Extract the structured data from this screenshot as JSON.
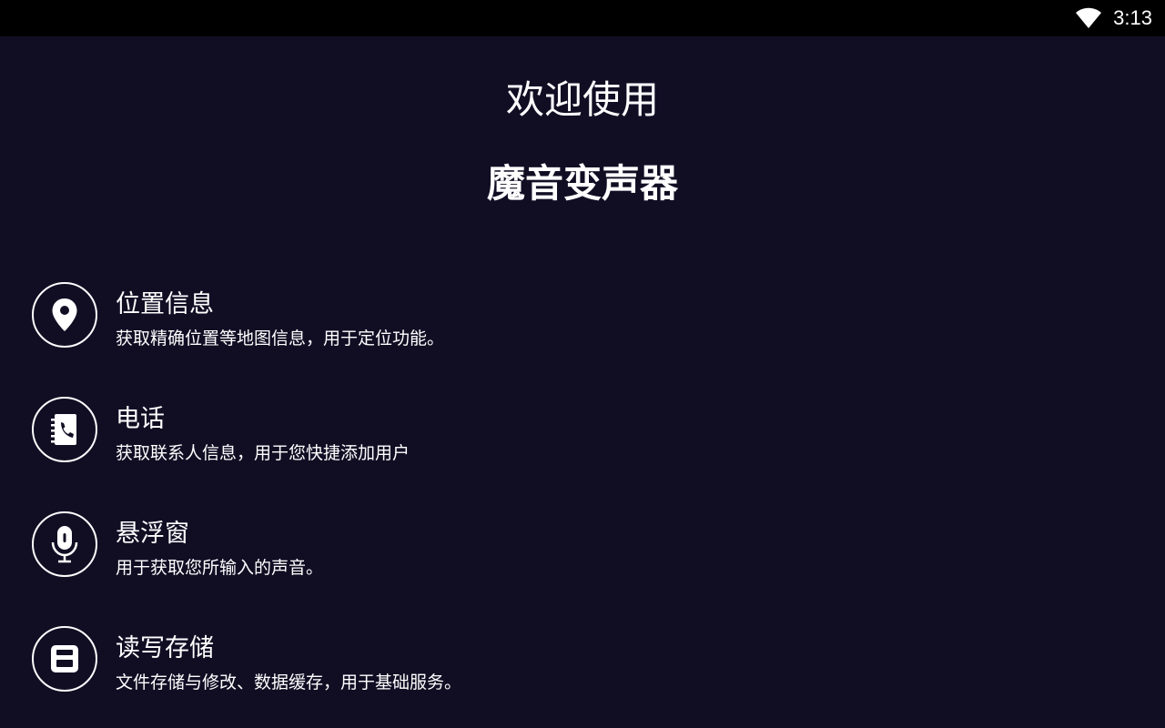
{
  "status_bar": {
    "time": "3:13",
    "wifi_icon": "wifi-icon"
  },
  "header": {
    "welcome": "欢迎使用",
    "app_name": "魔音变声器"
  },
  "permissions": [
    {
      "icon": "location-pin-icon",
      "title": "位置信息",
      "description": "获取精确位置等地图信息，用于定位功能。"
    },
    {
      "icon": "phone-contacts-icon",
      "title": "电话",
      "description": "获取联系人信息，用于您快捷添加用户"
    },
    {
      "icon": "microphone-icon",
      "title": "悬浮窗",
      "description": "用于获取您所输入的声音。"
    },
    {
      "icon": "storage-icon",
      "title": "读写存储",
      "description": "文件存储与修改、数据缓存，用于基础服务。"
    }
  ],
  "colors": {
    "background": "#110e24",
    "status_bar": "#000000",
    "foreground": "#ffffff"
  }
}
